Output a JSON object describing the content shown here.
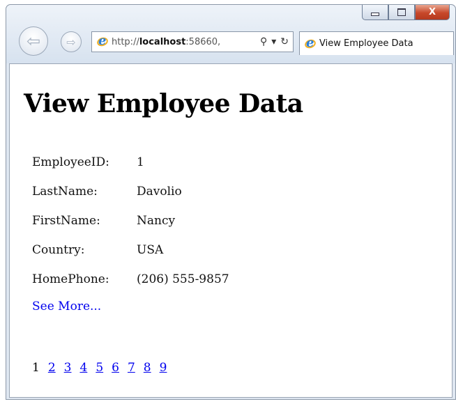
{
  "browser": {
    "window_buttons": {
      "minimize": "",
      "maximize": "",
      "close": "X"
    },
    "nav": {
      "back_glyph": "⇦",
      "forward_glyph": "⇨"
    },
    "address": {
      "url_prefix": "http://",
      "url_host": "localhost",
      "url_suffix": ":58660,",
      "search_glyph": "⚲",
      "dropdown_glyph": "▾",
      "refresh_glyph": "↻"
    },
    "tab": {
      "title": "View Employee Data"
    }
  },
  "page": {
    "heading": "View Employee Data",
    "fields": [
      {
        "label": "EmployeeID:",
        "value": "1"
      },
      {
        "label": "LastName:",
        "value": "Davolio"
      },
      {
        "label": "FirstName:",
        "value": "Nancy"
      },
      {
        "label": "Country:",
        "value": "USA"
      },
      {
        "label": "HomePhone:",
        "value": "(206) 555-9857"
      }
    ],
    "see_more": "See More...",
    "pager": {
      "current": "1",
      "pages": [
        "2",
        "3",
        "4",
        "5",
        "6",
        "7",
        "8",
        "9"
      ]
    }
  },
  "colors": {
    "link": "#0000ee",
    "close_button": "#c7482a",
    "ie_logo_blue": "#2a7ed8",
    "ie_logo_ring": "#f2b020"
  }
}
